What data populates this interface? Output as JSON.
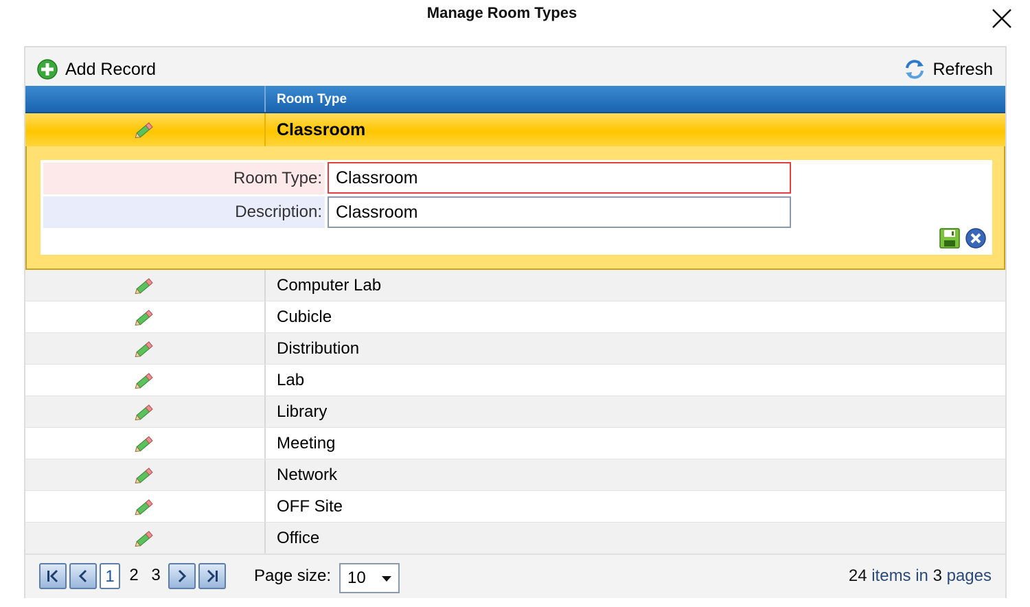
{
  "dialog": {
    "title": "Manage Room Types"
  },
  "toolbar": {
    "add_label": "Add Record",
    "refresh_label": "Refresh"
  },
  "grid": {
    "column_header": "Room Type",
    "selected_row": {
      "name": "Classroom"
    },
    "edit_form": {
      "room_type_label": "Room Type:",
      "room_type_value": "Classroom",
      "description_label": "Description:",
      "description_value": "Classroom"
    },
    "rows": [
      {
        "name": "Computer Lab"
      },
      {
        "name": "Cubicle"
      },
      {
        "name": "Distribution"
      },
      {
        "name": "Lab"
      },
      {
        "name": "Library"
      },
      {
        "name": "Meeting"
      },
      {
        "name": "Network"
      },
      {
        "name": "OFF Site"
      },
      {
        "name": "Office"
      }
    ]
  },
  "pager": {
    "pages": [
      "1",
      "2",
      "3"
    ],
    "current_page": "1",
    "page_size_label": "Page size:",
    "page_size_value": "10",
    "total_items": "24",
    "items_in_text": " items in ",
    "total_pages": "3",
    "pages_text": " pages"
  },
  "icons": {
    "close": "close-icon",
    "add": "add-icon",
    "refresh": "refresh-icon",
    "edit": "pencil-icon",
    "save": "save-icon",
    "cancel": "cancel-icon"
  },
  "colors": {
    "header_blue": "#1a63b0",
    "selected_yellow": "#ffc600",
    "required_red": "#e04040"
  }
}
